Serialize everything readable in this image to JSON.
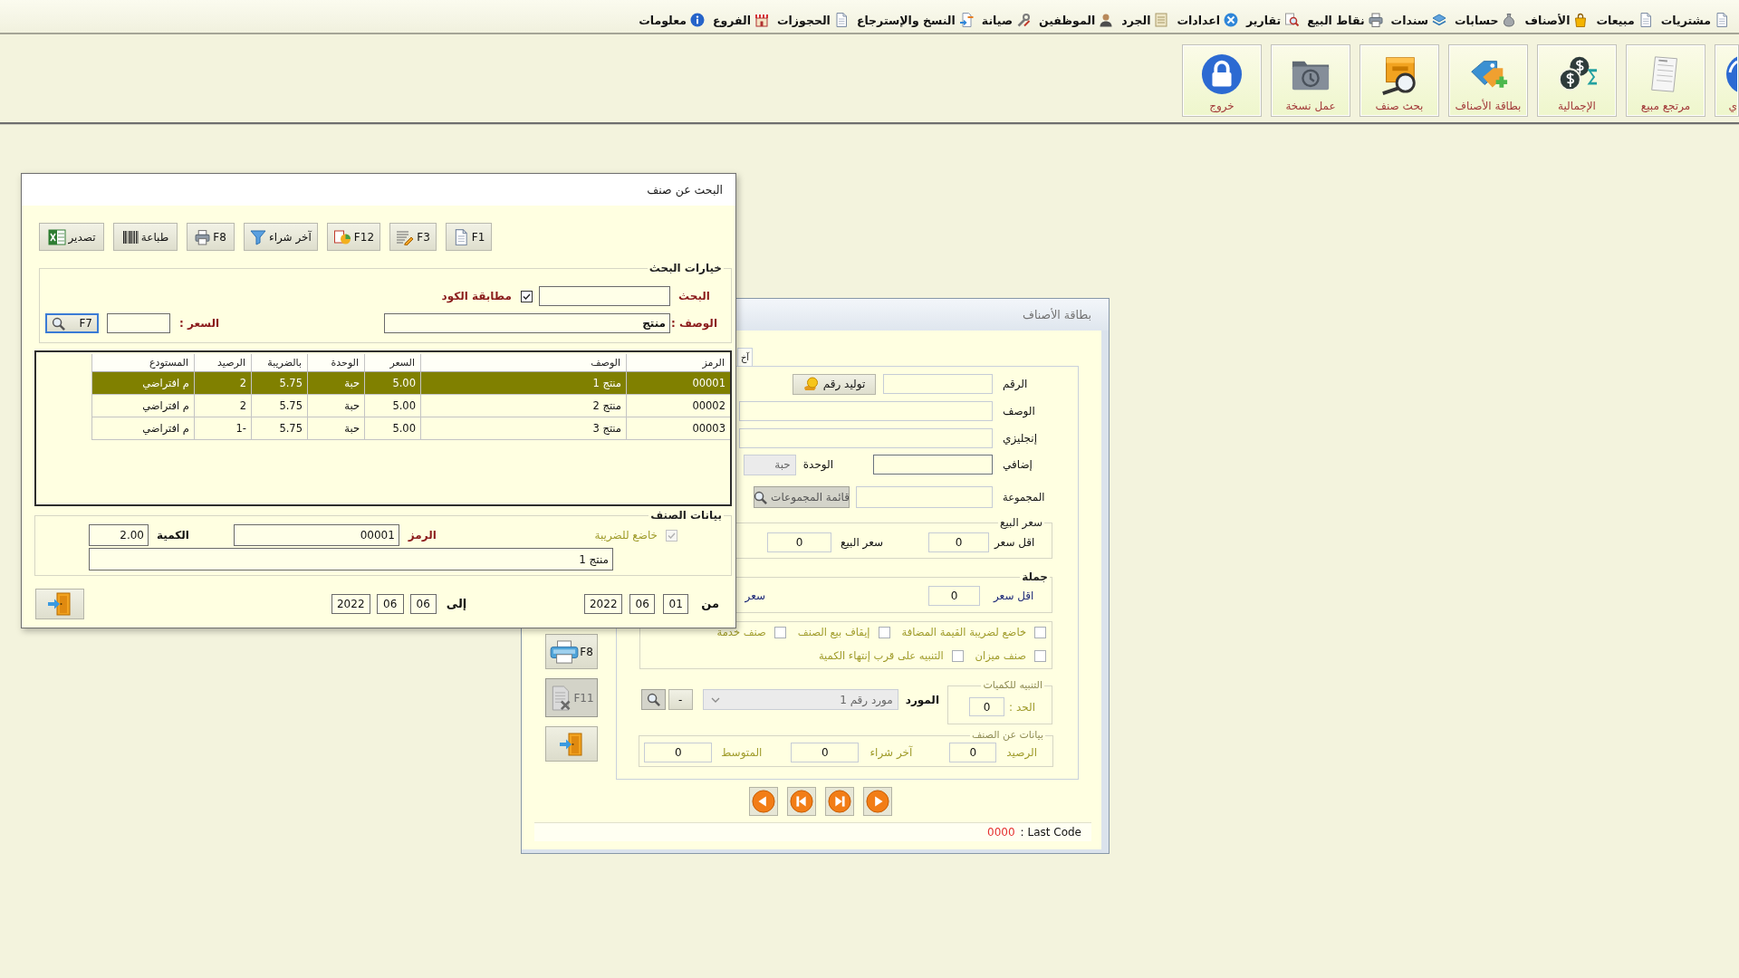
{
  "menu_bar": {
    "items": [
      {
        "label": "مشتريات"
      },
      {
        "label": "مبيعات"
      },
      {
        "label": "الأصناف"
      },
      {
        "label": "حسابات"
      },
      {
        "label": "سندات"
      },
      {
        "label": "نقاط البيع"
      },
      {
        "label": "تقارير"
      },
      {
        "label": "اعدادات"
      },
      {
        "label": "الجرد"
      },
      {
        "label": "الموظفين"
      },
      {
        "label": "صيانة"
      },
      {
        "label": "النسخ والإسترجاع"
      },
      {
        "label": "الحجوزات"
      },
      {
        "label": "الفروع"
      },
      {
        "label": "معلومات"
      }
    ]
  },
  "toolbar": {
    "buttons": [
      {
        "kind": "cut",
        "label": "ي"
      },
      {
        "kind": "full",
        "label": "مرتجع مبيع"
      },
      {
        "kind": "full",
        "label": "الإجمالية"
      },
      {
        "kind": "full",
        "label": "بطاقة الأصناف"
      },
      {
        "kind": "full",
        "label": "بحث صنف"
      },
      {
        "kind": "full",
        "label": "عمل نسخة"
      },
      {
        "kind": "full",
        "label": "خروج"
      }
    ]
  },
  "search_dialog": {
    "title": "البحث عن صنف",
    "toolbar": [
      {
        "label": "F1"
      },
      {
        "label": "F3"
      },
      {
        "label": "F12"
      },
      {
        "label": "آخر شراء"
      },
      {
        "label": "F8"
      },
      {
        "label": "طباعة"
      },
      {
        "label": "تصدير"
      }
    ],
    "options": {
      "title": "خيارات البحث",
      "search": {
        "label": "البحث"
      },
      "match_code": {
        "label": "مطابقة الكود",
        "checked": true
      },
      "description": {
        "label": "الوصف :",
        "value": "منتج"
      },
      "price": {
        "label": "السعر :"
      },
      "find_button": {
        "label": "F7",
        "focused": true
      }
    },
    "table": {
      "columns": [
        "الرمز",
        "الوصف",
        "السعر",
        "الوحدة",
        "بالضريبة",
        "الرصيد",
        "المستودع"
      ],
      "rows": [
        {
          "selected": true,
          "cells": [
            "00001",
            "منتج 1",
            "5.00",
            "حبة",
            "5.75",
            "2",
            "م افتراضي"
          ]
        },
        {
          "selected": false,
          "cells": [
            "00002",
            "منتج 2",
            "5.00",
            "حبة",
            "5.75",
            "2",
            "م افتراضي"
          ]
        },
        {
          "selected": false,
          "cells": [
            "00003",
            "منتج 3",
            "5.00",
            "حبة",
            "5.75",
            "1-",
            "م افتراضي"
          ]
        }
      ]
    },
    "item_data": {
      "title": "بيانات الصنف",
      "taxable": {
        "label": "خاضع للضريبة",
        "checked": true,
        "disabled": true
      },
      "code": {
        "label": "الرمز",
        "value": "00001"
      },
      "quantity": {
        "label": "الكمية",
        "value": "2.00"
      },
      "name": {
        "value": "منتج 1"
      }
    },
    "date_from": {
      "label": "من",
      "day": "01",
      "month": "06",
      "year": "2022"
    },
    "date_to": {
      "label": "إلى",
      "day": "06",
      "month": "06",
      "year": "2022"
    }
  },
  "item_card": {
    "title": "بطاقة الأصناف",
    "tab": {
      "label": "آخ"
    },
    "number": {
      "label": "الرقم"
    },
    "generate_button": {
      "label": "توليد رقم"
    },
    "description": {
      "label": "الوصف"
    },
    "english": {
      "label": "إنجليزي"
    },
    "extra": {
      "label": "إضافي",
      "focused": true
    },
    "unit": {
      "label": "الوحدة",
      "value": "حبة",
      "disabled": true
    },
    "group": {
      "label": "المجموعة"
    },
    "group_list_button": {
      "label": "قائمة المجموعات",
      "disabled": true
    },
    "sale_price": {
      "title": "سعر البيع",
      "min_label": "اقل سعر",
      "min_value": "0",
      "price_label": "سعر البيع",
      "price_value": "0"
    },
    "wholesale": {
      "title": "جملة",
      "min_label": "اقل سعر",
      "min_value": "0",
      "price_label": "سعر"
    },
    "option_rows": [
      {
        "options": [
          {
            "label": "خاضع لضريبة القيمة المضافة",
            "checked": false
          },
          {
            "label": "إيقاف بيع الصنف",
            "checked": false
          },
          {
            "label": "صنف خدمة",
            "checked": false
          }
        ]
      },
      {
        "options": [
          {
            "label": "صنف ميزان",
            "checked": false
          },
          {
            "label": "التنبيه على قرب إنتهاء الكمية",
            "checked": false
          }
        ]
      }
    ],
    "quantity_alert": {
      "title": "التنبيه للكميات",
      "limit_label": "الحد :",
      "limit_value": "0"
    },
    "supplier": {
      "label": "المورد",
      "value": "مورد رقم 1",
      "disabled": true
    },
    "remove_button": {
      "label": "-"
    },
    "item_info": {
      "title": "بيانات عن الصنف",
      "balance_label": "الرصيد",
      "balance_value": "0",
      "last_purchase_label": "آخر شراء",
      "last_purchase_value": "0",
      "average_label": "المتوسط",
      "average_value": "0"
    },
    "side_buttons": [
      {
        "label": "F8",
        "disabled": false
      },
      {
        "label": "F11",
        "disabled": true
      }
    ],
    "status": {
      "label": ": Last Code",
      "value": "0000"
    }
  }
}
